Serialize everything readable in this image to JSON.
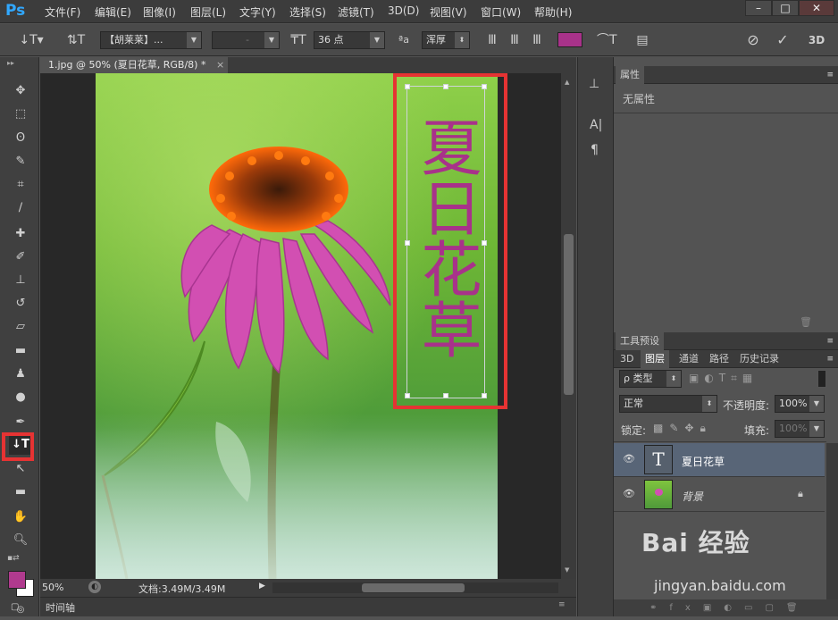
{
  "app": {
    "logo": "Ps"
  },
  "menu": [
    "文件(F)",
    "编辑(E)",
    "图像(I)",
    "图层(L)",
    "文字(Y)",
    "选择(S)",
    "滤镜(T)",
    "3D(D)",
    "视图(V)",
    "窗口(W)",
    "帮助(H)"
  ],
  "window_controls": [
    "–",
    "□",
    "✕"
  ],
  "options": {
    "font_family": "【胡莱莱】...",
    "font_style": "-",
    "font_size": "36 点",
    "aa_label": "ªa",
    "anti_alias": "浑厚",
    "text_color": "#a8328a",
    "workspace_3d": "3D"
  },
  "document": {
    "tab_title": "1.jpg @ 50% (夏日花草, RGB/8) *",
    "close": "×",
    "text_layer_content": "夏日花草",
    "zoom": "50%",
    "doc_size": "文档:3.49M/3.49M"
  },
  "timeline": {
    "label": "时间轴"
  },
  "properties": {
    "tab": "属性",
    "empty": "无属性"
  },
  "tool_presets": {
    "tab": "工具预设"
  },
  "layers_panel": {
    "tabs": [
      "3D",
      "图层",
      "通道",
      "路径",
      "历史记录"
    ],
    "active_tab": "图层",
    "filter_kind": "ρ 类型",
    "blend_mode": "正常",
    "opacity_label": "不透明度:",
    "opacity": "100%",
    "lock_label": "锁定:",
    "fill_label": "填充:",
    "fill": "100%",
    "layers": [
      {
        "name": "夏日花草",
        "type": "text",
        "selected": true
      },
      {
        "name": "背景",
        "type": "image",
        "selected": false,
        "locked": true
      }
    ]
  },
  "watermark": {
    "brand": "Bai 经验",
    "url": "jingyan.baidu.com"
  },
  "colors": {
    "foreground": "#b03a8e",
    "background": "#ffffff",
    "highlight": "#e63333",
    "text_layer": "#a8328a"
  }
}
